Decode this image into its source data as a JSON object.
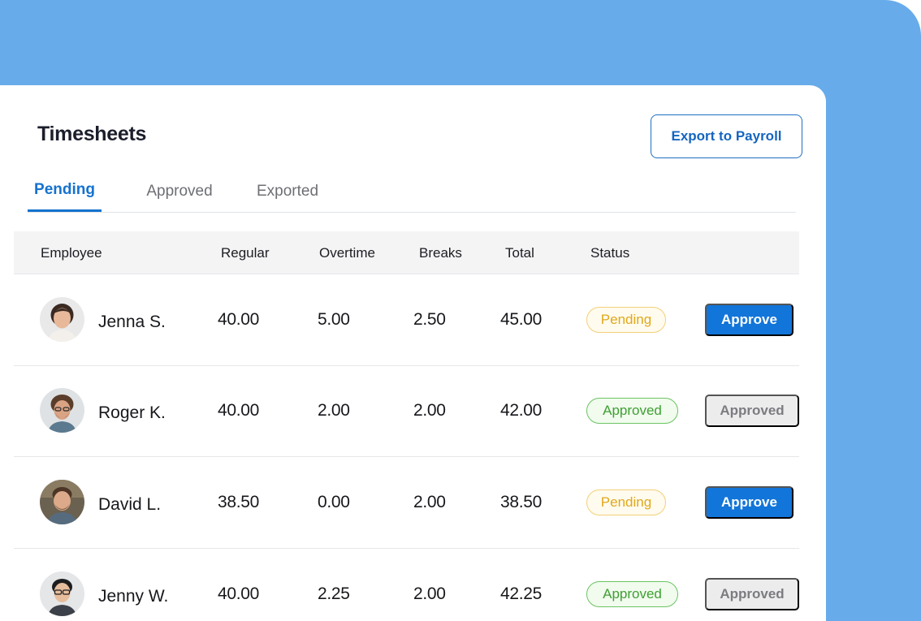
{
  "header": {
    "title": "Timesheets",
    "export_label": "Export to Payroll"
  },
  "tabs": [
    {
      "label": "Pending",
      "active": true
    },
    {
      "label": "Approved",
      "active": false
    },
    {
      "label": "Exported",
      "active": false
    }
  ],
  "columns": {
    "employee": "Employee",
    "regular": "Regular",
    "overtime": "Overtime",
    "breaks": "Breaks",
    "total": "Total",
    "status": "Status"
  },
  "rows": [
    {
      "name": "Jenna S.",
      "regular": "40.00",
      "overtime": "5.00",
      "breaks": "2.50",
      "total": "45.00",
      "status": "Pending",
      "action": "Approve"
    },
    {
      "name": "Roger K.",
      "regular": "40.00",
      "overtime": "2.00",
      "breaks": "2.00",
      "total": "42.00",
      "status": "Approved",
      "action": "Approved"
    },
    {
      "name": "David L.",
      "regular": "38.50",
      "overtime": "0.00",
      "breaks": "2.00",
      "total": "38.50",
      "status": "Pending",
      "action": "Approve"
    },
    {
      "name": "Jenny W.",
      "regular": "40.00",
      "overtime": "2.25",
      "breaks": "2.00",
      "total": "42.25",
      "status": "Approved",
      "action": "Approved"
    }
  ],
  "colors": {
    "accent": "#1275d9",
    "backdrop": "#67abea",
    "pending": "#e0a81c",
    "approved": "#3f9f33"
  }
}
